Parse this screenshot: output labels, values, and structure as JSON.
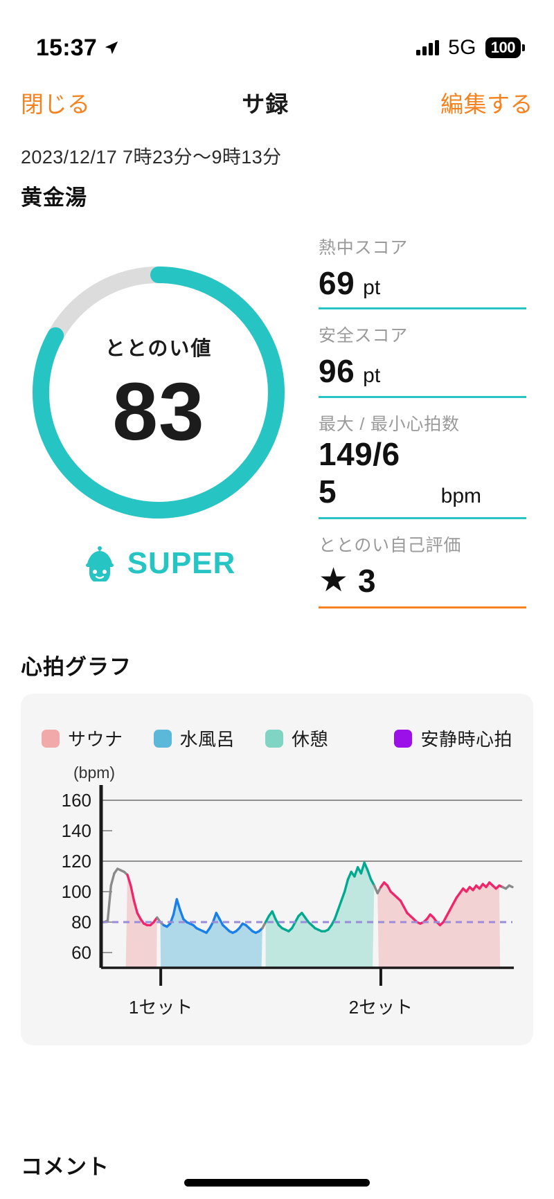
{
  "status_bar": {
    "time": "15:37",
    "location_icon": "location-arrow-icon",
    "signal_icon": "cellular-bars-icon",
    "network": "5G",
    "battery": "100"
  },
  "nav": {
    "close_label": "閉じる",
    "title": "サ録",
    "edit_label": "編集する"
  },
  "header": {
    "date_range": "2023/12/17 7時23分〜9時13分",
    "venue": "黄金湯"
  },
  "gauge": {
    "label": "ととのい値",
    "value": "83",
    "percent": 83,
    "track_color": "#DCDCDC",
    "arc_color": "#27C4C4",
    "rank_label": "SUPER",
    "rank_icon": "sauna-hat-character-icon",
    "rank_color": "#27C4C4"
  },
  "stats": [
    {
      "label": "熱中スコア",
      "value": "69",
      "unit": "pt",
      "rule_color": "#27C4C4"
    },
    {
      "label": "安全スコア",
      "value": "96",
      "unit": "pt",
      "rule_color": "#27C4C4"
    },
    {
      "label": "最大 / 最小心拍数",
      "value_line1": "149/6",
      "value_line2": "5",
      "unit": "bpm",
      "rule_color": "#27C4C4"
    },
    {
      "label": "ととのい自己評価",
      "star_icon": "★",
      "value": "3",
      "rule_color": "#F5811F"
    }
  ],
  "chart_section": {
    "title": "心拍グラフ",
    "legend": [
      {
        "label": "サウナ",
        "color": "#F2A9A9"
      },
      {
        "label": "水風呂",
        "color": "#5BB8D8"
      },
      {
        "label": "休憩",
        "color": "#7FD4C4"
      },
      {
        "label": "安静時心拍",
        "color": "#9B0FE8"
      }
    ],
    "unit_label": "(bpm)"
  },
  "chart_data": {
    "type": "line",
    "title": "心拍グラフ",
    "xlabel": "",
    "ylabel": "(bpm)",
    "ylim": [
      50,
      170
    ],
    "yticks": [
      60,
      80,
      100,
      120,
      140,
      160
    ],
    "gridlines": [
      120,
      160
    ],
    "grid": true,
    "legend_position": "top",
    "x_markers": [
      {
        "label": "1セット",
        "x_pct": 14.5
      },
      {
        "label": "2セット",
        "x_pct": 68.0
      }
    ],
    "resting_hr": 80,
    "resting_hr_color": "#9B8CD8",
    "phases": [
      {
        "name": "サウナ",
        "start_pct": 6.0,
        "end_pct": 13.5,
        "fill": "#F2A9A9",
        "line_color": "#F0256A"
      },
      {
        "name": "水風呂",
        "start_pct": 14.5,
        "end_pct": 39.0,
        "fill": "#5BB8D8",
        "line_color": "#1A7FE8"
      },
      {
        "name": "休憩",
        "start_pct": 40.0,
        "end_pct": 66.0,
        "fill": "#7FD4C4",
        "line_color": "#00A98F"
      },
      {
        "name": "サウナ",
        "start_pct": 67.5,
        "end_pct": 97.0,
        "fill": "#F2A9A9",
        "line_color": "#F0256A"
      }
    ],
    "series": [
      {
        "name": "心拍数",
        "unit": "bpm",
        "values": [
          80,
          80,
          81,
          104,
          112,
          115,
          114,
          113,
          111,
          104,
          94,
          86,
          82,
          79,
          78,
          78,
          80,
          83,
          80,
          78,
          77,
          79,
          85,
          95,
          88,
          82,
          80,
          79,
          78,
          76,
          75,
          74,
          73,
          76,
          80,
          86,
          82,
          78,
          76,
          74,
          73,
          74,
          76,
          79,
          78,
          76,
          74,
          73,
          74,
          76,
          80,
          84,
          87,
          82,
          78,
          76,
          75,
          74,
          76,
          80,
          84,
          86,
          83,
          80,
          78,
          76,
          75,
          74,
          74,
          75,
          78,
          82,
          88,
          94,
          100,
          108,
          113,
          110,
          116,
          112,
          119,
          114,
          108,
          104,
          99,
          103,
          106,
          104,
          100,
          98,
          96,
          94,
          90,
          86,
          84,
          82,
          80,
          79,
          80,
          82,
          85,
          83,
          80,
          78,
          80,
          84,
          88,
          92,
          96,
          99,
          102,
          100,
          103,
          101,
          104,
          102,
          105,
          103,
          106,
          104,
          102,
          104,
          103,
          102,
          104,
          103
        ]
      }
    ]
  },
  "comment": {
    "title": "コメント"
  }
}
